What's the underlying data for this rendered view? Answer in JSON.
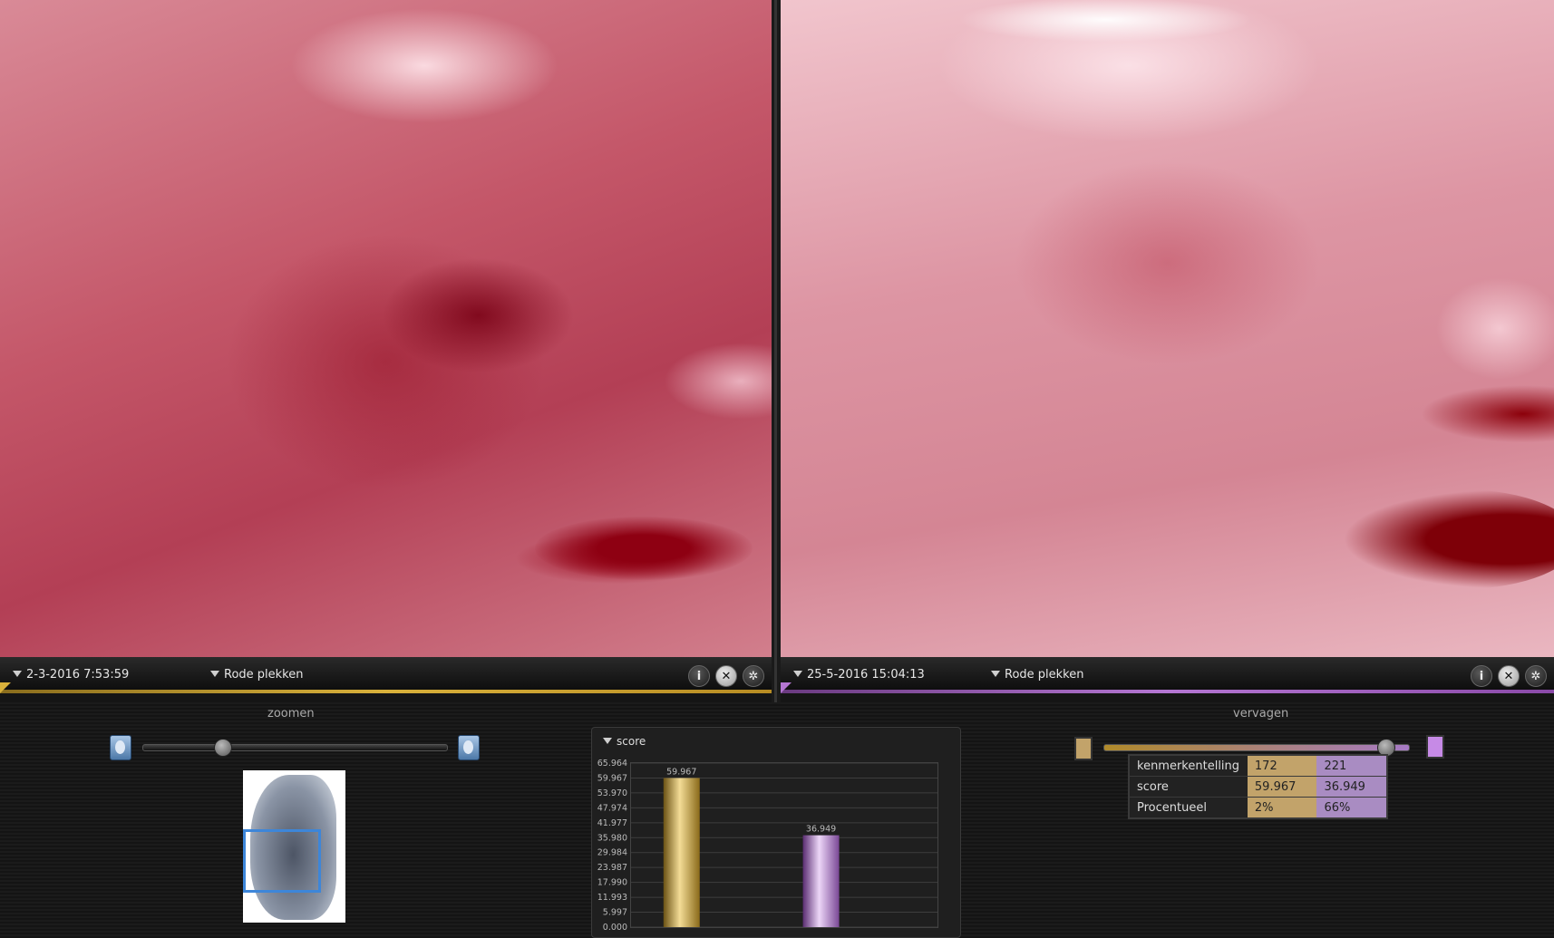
{
  "left_view": {
    "timestamp": "2-3-2016 7:53:59",
    "mode": "Rode plekken",
    "accent": "#d9b13b"
  },
  "right_view": {
    "timestamp": "25-5-2016 15:04:13",
    "mode": "Rode plekken",
    "accent": "#b476d2"
  },
  "view_buttons": {
    "info_icon": "info-icon",
    "close_icon": "close-icon",
    "settings_icon": "gear-icon",
    "info_glyph": "i",
    "close_glyph": "✕",
    "settings_glyph": "✲"
  },
  "zoom": {
    "label": "zoomen",
    "level": 0.25
  },
  "fade": {
    "label": "vervagen",
    "level": 0.95
  },
  "chart_data": {
    "type": "bar",
    "title": "score",
    "categories": [
      "2-3-2016 7:53:59",
      "25-5-2016 15:04:13"
    ],
    "values": [
      59.967,
      36.949
    ],
    "value_labels": [
      "59.967",
      "36.949"
    ],
    "colors": [
      "#c5a04a",
      "#a67ac4"
    ],
    "ylim": [
      0,
      65.964
    ],
    "yticks": [
      "65.964",
      "59.967",
      "53.970",
      "47.974",
      "41.977",
      "35.980",
      "29.984",
      "23.987",
      "17.990",
      "11.993",
      "5.997",
      "0.000"
    ],
    "grid": true
  },
  "stats": {
    "rows": [
      {
        "label": "kenmerkentelling",
        "a": "172",
        "b": "221"
      },
      {
        "label": "score",
        "a": "59.967",
        "b": "36.949"
      },
      {
        "label": "Procentueel",
        "a": "2%",
        "b": "66%"
      }
    ]
  }
}
